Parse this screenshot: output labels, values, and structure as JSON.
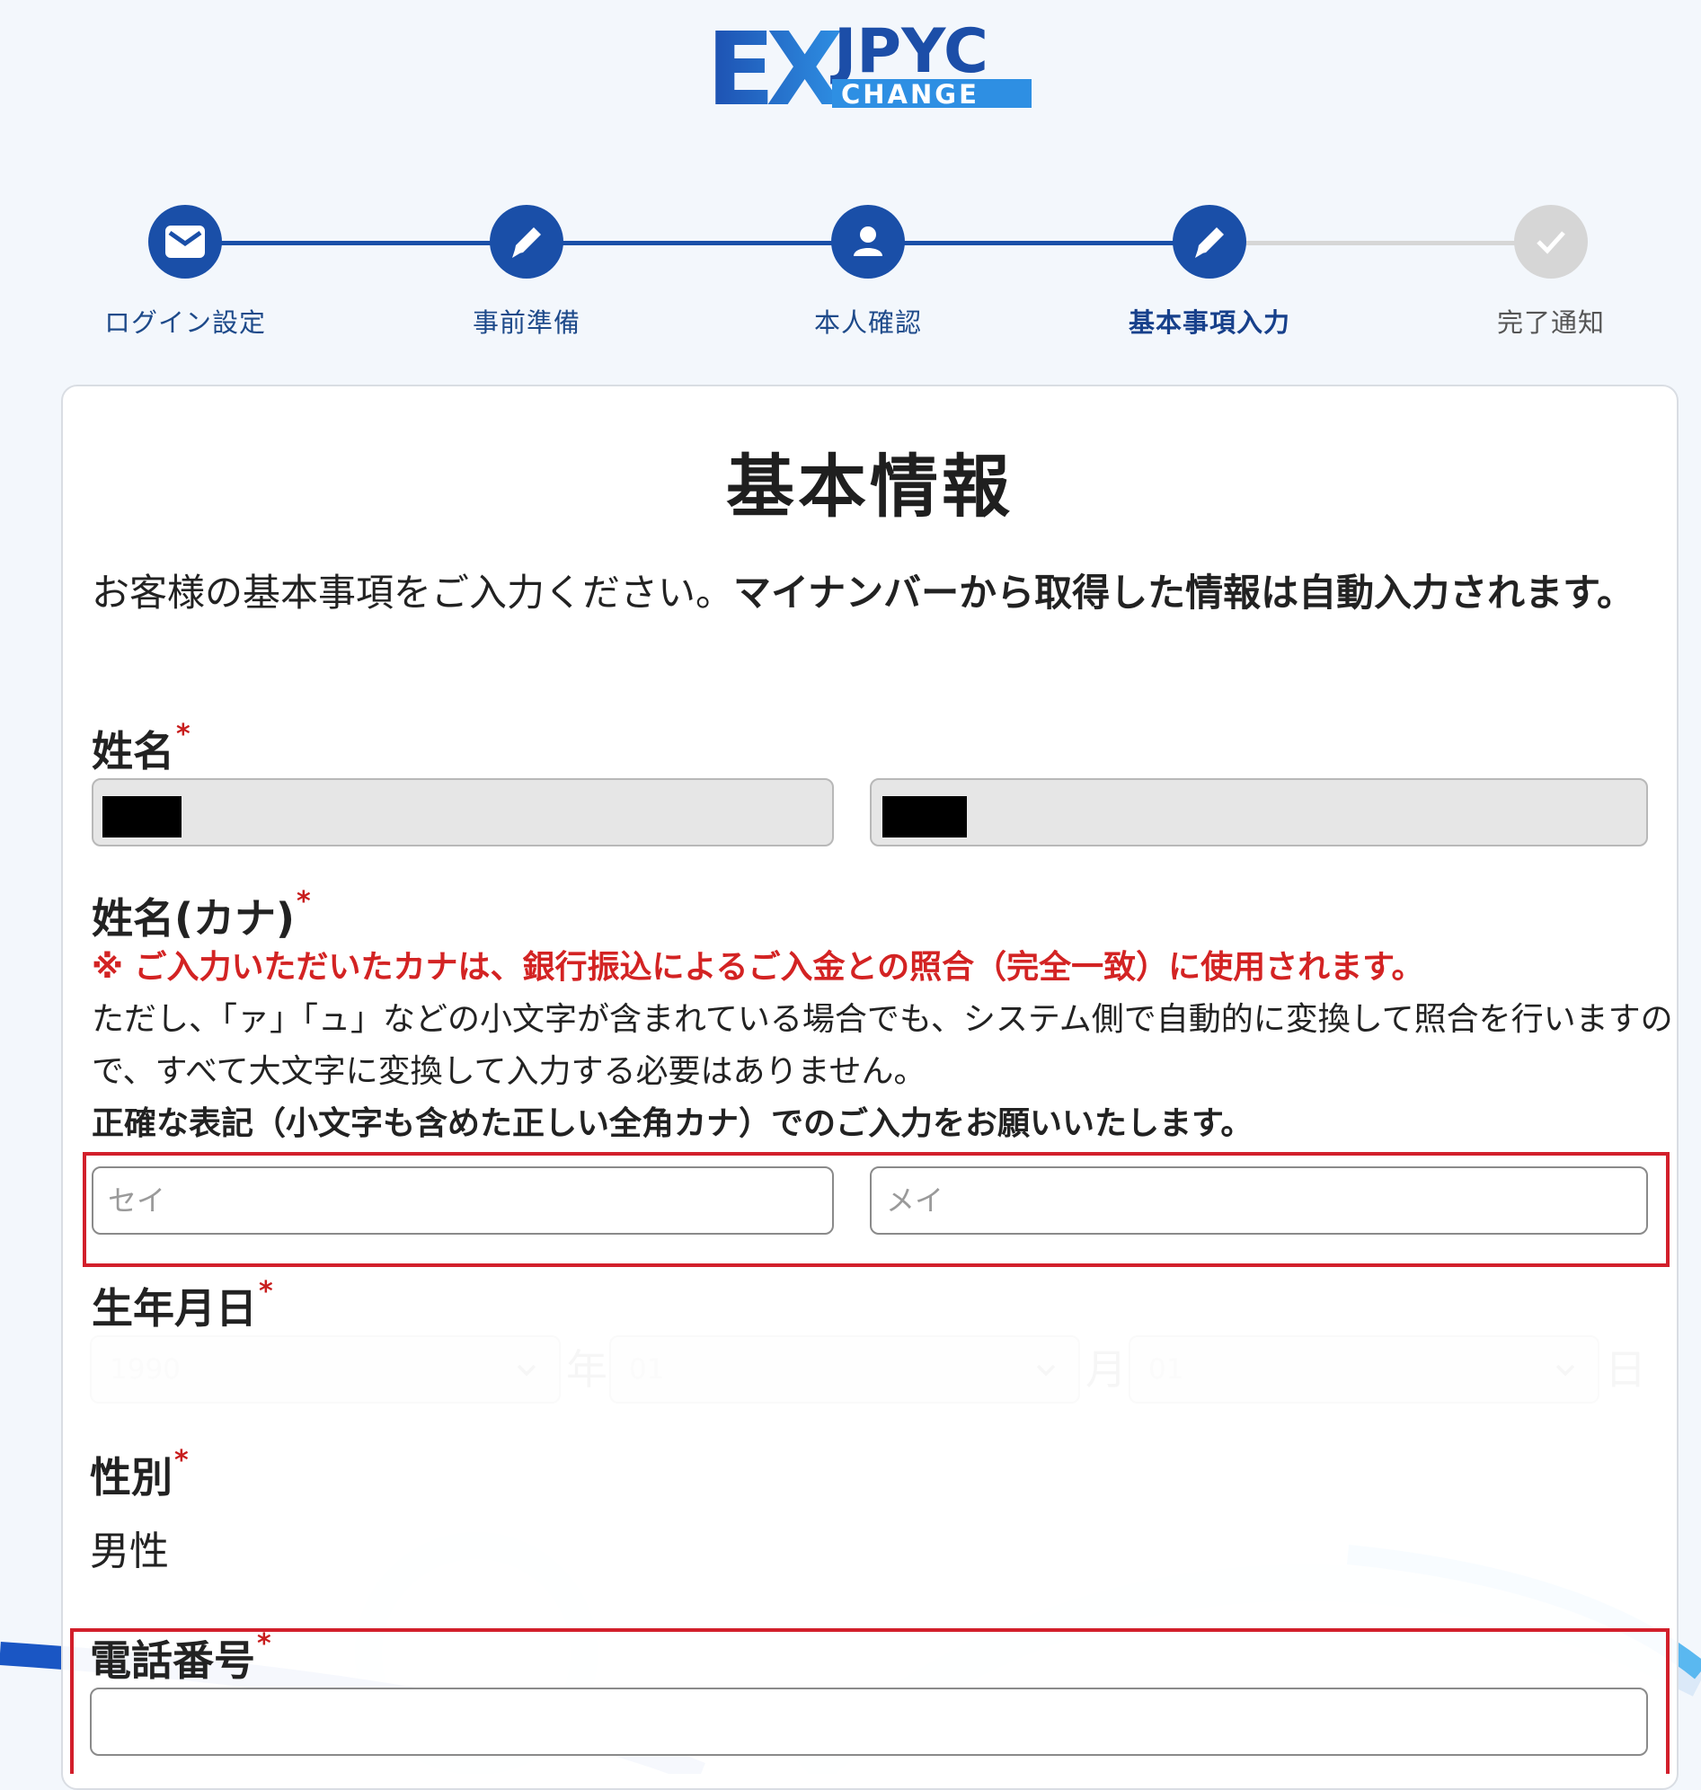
{
  "brand": {
    "ex": "EX",
    "jpyc": "JPYC",
    "change": "CHANGE",
    "colors": {
      "primary": "#1a4fa8",
      "accent": "#2c8ee0",
      "highlight": "#d21f2b"
    }
  },
  "steps": [
    {
      "label": "ログイン設定",
      "icon": "envelope-icon",
      "state": "done"
    },
    {
      "label": "事前準備",
      "icon": "pencil-icon",
      "state": "done"
    },
    {
      "label": "本人確認",
      "icon": "user-icon",
      "state": "done"
    },
    {
      "label": "基本事項入力",
      "icon": "pencil-icon",
      "state": "active"
    },
    {
      "label": "完了通知",
      "icon": "check-icon",
      "state": "pending"
    }
  ],
  "form": {
    "title": "基本情報",
    "intro_normal": "お客様の基本事項をご入力ください。",
    "intro_bold": "マイナンバーから取得した情報は自動入力されます。",
    "name": {
      "label": "姓名",
      "required": "*"
    },
    "kana": {
      "label": "姓名(カナ)",
      "required": "*",
      "warning": "※ ご入力いただいたカナは、銀行振込によるご入金との照合（完全一致）に使用されます。",
      "note": "ただし、「ァ」「ュ」などの小文字が含まれている場合でも、システム側で自動的に変換して照合を行いますので、すべて大文字に変換して入力する必要はありません。",
      "emphasis": "正確な表記（小文字も含めた正しい全角カナ）でのご入力をお願いいたします。",
      "sei_placeholder": "セイ",
      "mei_placeholder": "メイ"
    },
    "birth": {
      "label": "生年月日",
      "required": "*",
      "year": "1990",
      "year_unit": "年",
      "month": "01",
      "month_unit": "月",
      "day": "01",
      "day_unit": "日"
    },
    "gender": {
      "label": "性別",
      "required": "*",
      "value": "男性"
    },
    "phone": {
      "label": "電話番号",
      "required": "*",
      "value": ""
    }
  }
}
